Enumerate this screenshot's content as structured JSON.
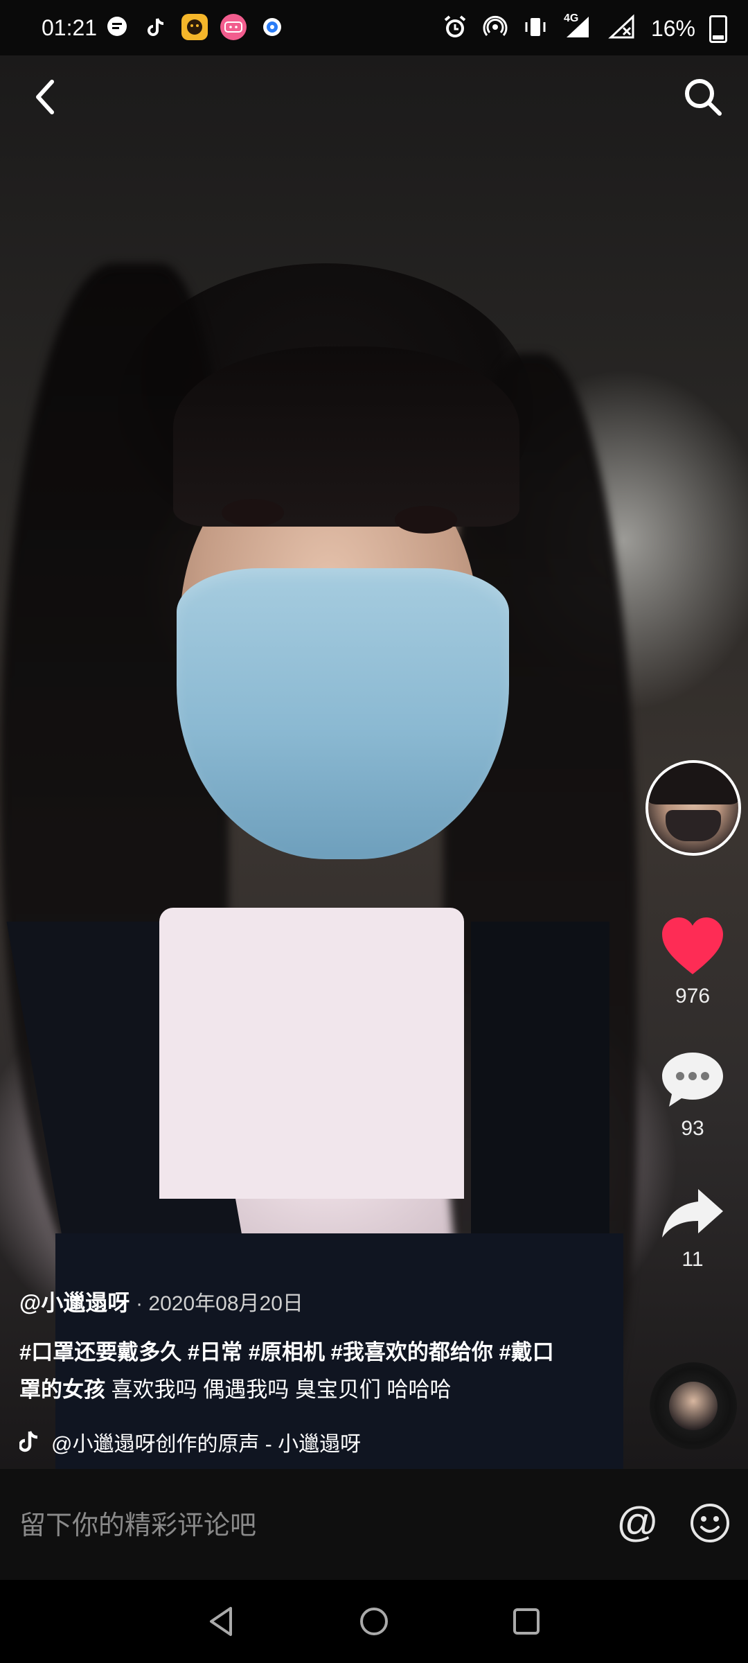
{
  "status_bar": {
    "time": "01:21",
    "network": "4G",
    "battery": "16%",
    "battery_level": 0.16,
    "left_icons": [
      "message-icon",
      "tiktok-icon",
      "app-icon-yellow",
      "bilibili-icon",
      "browser-icon"
    ],
    "right_icons": [
      "alarm-icon",
      "hotspot-icon",
      "vibrate-icon",
      "signal-icon",
      "signal-empty-icon",
      "battery-icon"
    ]
  },
  "video": {
    "author": "@小邋遢呀",
    "date": "· 2020年08月20日",
    "caption_tags": [
      "#口罩还要戴多久",
      "#日常",
      "#原相机",
      "#我喜欢的都给你",
      "#戴口罩的女孩"
    ],
    "caption_text": "喜欢我吗 偶遇我吗 臭宝贝们 哈哈哈",
    "music": "@小邋遢呀创作的原声 - 小邋遢呀"
  },
  "actions": {
    "likes": "976",
    "comments": "93",
    "shares": "11"
  },
  "comment_bar": {
    "placeholder": "留下你的精彩评论吧",
    "at_symbol": "@"
  },
  "colors": {
    "like": "#fe2c55",
    "background": "#000000"
  }
}
